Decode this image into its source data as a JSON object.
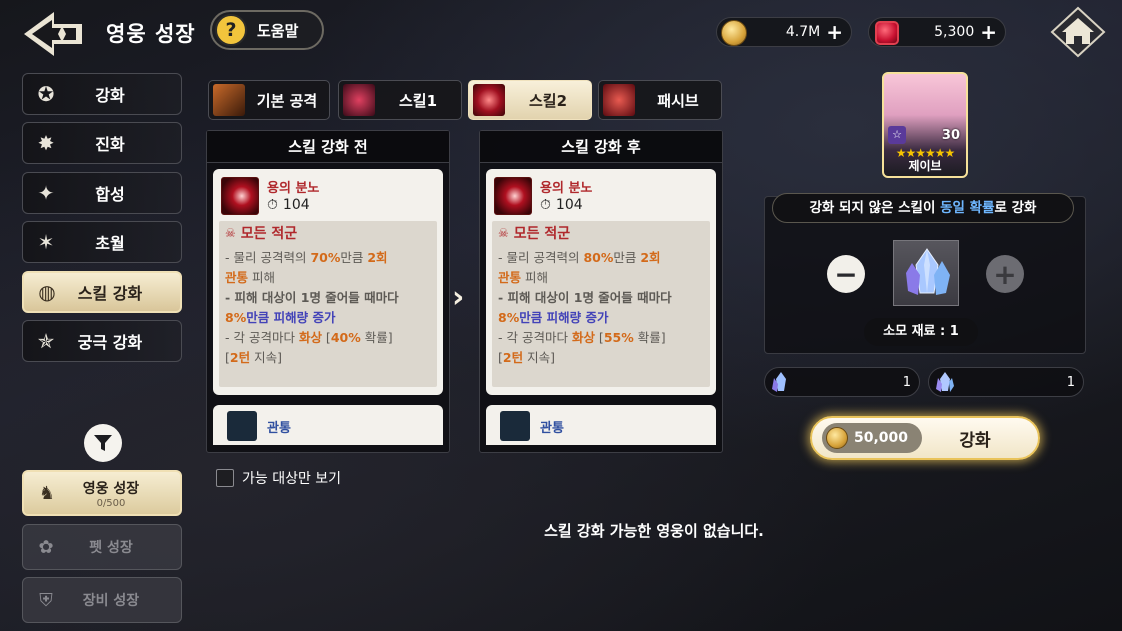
{
  "header": {
    "title": "영웅 성장",
    "help_label": "도움말"
  },
  "currency": {
    "gold": "4.7M",
    "ruby": "5,300"
  },
  "left_menu": [
    {
      "label": "강화",
      "icon": "shield-star-icon",
      "active": false
    },
    {
      "label": "진화",
      "icon": "burst-star-icon",
      "active": false
    },
    {
      "label": "합성",
      "icon": "fusion-icon",
      "active": false
    },
    {
      "label": "초월",
      "icon": "six-point-star-icon",
      "active": false
    },
    {
      "label": "스킬 강화",
      "icon": "orb-swirl-icon",
      "active": true
    },
    {
      "label": "궁극 강화",
      "icon": "ultimate-star-icon",
      "active": false
    }
  ],
  "bottom_menu": {
    "hero": {
      "label": "영웅 성장",
      "sub": "0/500"
    },
    "pet": {
      "label": "펫 성장"
    },
    "gear": {
      "label": "장비 성장"
    }
  },
  "tabs": [
    {
      "label": "기본 공격",
      "active": false
    },
    {
      "label": "스킬1",
      "active": false
    },
    {
      "label": "스킬2",
      "active": true
    },
    {
      "label": "패시브",
      "active": false
    }
  ],
  "before": {
    "header": "스킬 강화 전",
    "skill_name": "용의 분노",
    "cooldown": "104",
    "target": "모든 적군",
    "line1_pre": "- 물리 공격력의 ",
    "line1_pct": "70%",
    "line1_mid": "만큼 ",
    "line1_hits": "2회",
    "line2_hl": "관통",
    "line2_post": " 피해",
    "line3": "- 피해 대상이 1명 줄어들 때마다",
    "line4_pct": "8%",
    "line4_post": "만큼 피해량 증가",
    "line5_pre": "- 각 공격마다 ",
    "line5_burn": "화상",
    "line5_b1": " [",
    "line5_pct": "40%",
    "line5_b2": " 확률]",
    "line6_pre": "[",
    "line6_turn": "2턴",
    "line6_post": " 지속]",
    "next_skill": "관통"
  },
  "after": {
    "header": "스킬 강화 후",
    "skill_name": "용의 분노",
    "cooldown": "104",
    "target": "모든 적군",
    "line1_pre": "- 물리 공격력의 ",
    "line1_pct": "80%",
    "line1_mid": "만큼 ",
    "line1_hits": "2회",
    "line2_hl": "관통",
    "line2_post": " 피해",
    "line3": "- 피해 대상이 1명 줄어들 때마다",
    "line4_pct": "8%",
    "line4_post": "만큼 피해량 증가",
    "line5_pre": "- 각 공격마다 ",
    "line5_burn": "화상",
    "line5_b1": " [",
    "line5_pct": "55%",
    "line5_b2": " 확률]",
    "line6_pre": "[",
    "line6_turn": "2턴",
    "line6_post": " 지속]",
    "next_skill": "관통"
  },
  "hero": {
    "name": "제이브",
    "level": "30"
  },
  "rule": {
    "pre": "강화 되지 않은 스킬이 ",
    "hl": "동일 확률",
    "post": "로 강화"
  },
  "cost_label": "소모 재료 : 1",
  "slots": [
    {
      "count": "1"
    },
    {
      "count": "1"
    }
  ],
  "enhance": {
    "cost": "50,000",
    "label": "강화"
  },
  "filter_label": "가능 대상만 보기",
  "empty_msg": "스킬 강화 가능한 영웅이 없습니다.",
  "colors": {
    "accent_gold": "#f2c43c",
    "orange": "#d36a1a",
    "blue": "#4242b8",
    "skill_red": "#b0282c"
  }
}
